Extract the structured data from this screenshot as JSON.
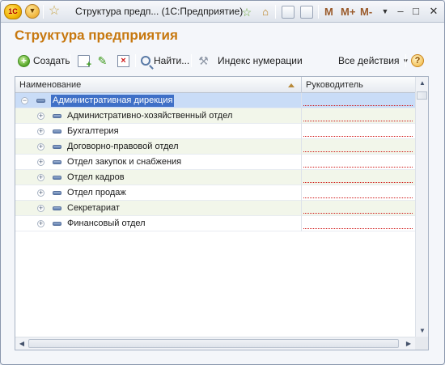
{
  "titlebar": {
    "logo_text": "1С",
    "window_title": "Структура предп...  (1С:Предприятие)",
    "m_buttons": [
      "M",
      "M+",
      "M-"
    ],
    "win_controls": {
      "minimize": "–",
      "restore": "□",
      "close": "✕"
    }
  },
  "form": {
    "title": "Структура предприятия"
  },
  "toolbar": {
    "create_label": "Создать",
    "find_label": "Найти...",
    "index_label": "Индекс нумерации",
    "all_actions_label": "Все действия",
    "help_symbol": "?"
  },
  "table": {
    "columns": [
      "Наименование",
      "Руководитель"
    ],
    "rows": [
      {
        "label": "Административная дирекция",
        "level": 0,
        "expander": "−",
        "selected": true
      },
      {
        "label": "Административно-хозяйственный отдел",
        "level": 1,
        "expander": "+",
        "selected": false
      },
      {
        "label": "Бухгалтерия",
        "level": 1,
        "expander": "+",
        "selected": false
      },
      {
        "label": "Договорно-правовой отдел",
        "level": 1,
        "expander": "+",
        "selected": false
      },
      {
        "label": "Отдел закупок и снабжения",
        "level": 1,
        "expander": "+",
        "selected": false
      },
      {
        "label": "Отдел кадров",
        "level": 1,
        "expander": "+",
        "selected": false
      },
      {
        "label": "Отдел продаж",
        "level": 1,
        "expander": "+",
        "selected": false
      },
      {
        "label": "Секретариат",
        "level": 1,
        "expander": "+",
        "selected": false
      },
      {
        "label": "Финансовый отдел",
        "level": 1,
        "expander": "+",
        "selected": false
      }
    ]
  },
  "colors": {
    "title_orange": "#c7780f",
    "selection_blue": "#3f70c7",
    "row_alt_green": "#f2f6ea"
  }
}
